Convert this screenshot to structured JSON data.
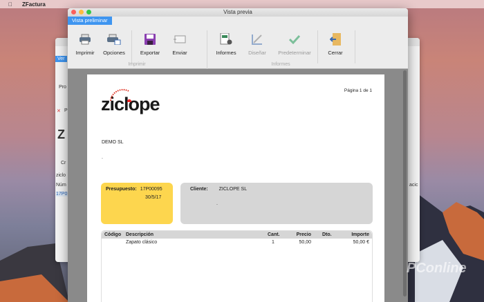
{
  "menubar": {
    "app": "ZFactura"
  },
  "back_window": {
    "fragments": [
      "Ver",
      "Pro",
      "P",
      "Z",
      "Cr",
      "ziclo",
      "Núm",
      "17P0",
      "acic"
    ]
  },
  "window": {
    "title": "Vista previa",
    "tab": "Vista preliminar"
  },
  "toolbar": {
    "buttons": [
      {
        "label": "Imprimir",
        "icon": "printer-icon",
        "enabled": true
      },
      {
        "label": "Opciones",
        "icon": "printer-settings-icon",
        "enabled": true
      },
      {
        "label": "Exportar",
        "icon": "floppy-disk-icon",
        "enabled": true
      },
      {
        "label": "Enviar",
        "icon": "envelope-icon",
        "enabled": true
      },
      {
        "label": "Informes",
        "icon": "report-gear-icon",
        "enabled": true
      },
      {
        "label": "Diseñar",
        "icon": "design-ruler-icon",
        "enabled": false
      },
      {
        "label": "Predeterminar",
        "icon": "checkmark-icon",
        "enabled": false
      },
      {
        "label": "Cerrar",
        "icon": "exit-door-icon",
        "enabled": true
      }
    ],
    "groups": [
      "Imprimir",
      "Informes"
    ]
  },
  "document": {
    "logo": "ziclope",
    "page_info": "Página 1 de 1",
    "company": "DEMO SL",
    "company_line2": ".",
    "quote_label": "Presupuesto:",
    "quote_number": "17P00095",
    "quote_date": "30/5/17",
    "client_label": "Cliente:",
    "client_name": "ZICLOPE SL",
    "client_line2": ".",
    "table": {
      "headers": [
        "Código",
        "Descripción",
        "Cant.",
        "Precio",
        "Dto.",
        "Importe"
      ],
      "rows": [
        [
          "",
          "Zapato clásico",
          "1",
          "50,00",
          "",
          "50,00 €"
        ]
      ]
    }
  },
  "watermark": "PConline"
}
